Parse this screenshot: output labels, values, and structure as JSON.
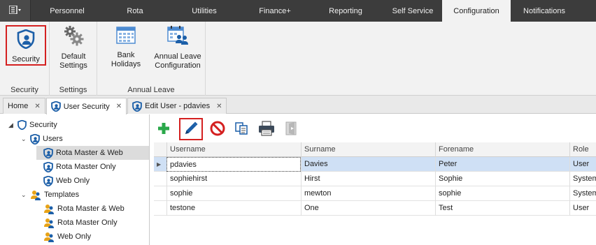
{
  "menubar": {
    "tabs": [
      {
        "label": "Personnel"
      },
      {
        "label": "Rota"
      },
      {
        "label": "Utilities"
      },
      {
        "label": "Finance+"
      },
      {
        "label": "Reporting"
      },
      {
        "label": "Self Service"
      },
      {
        "label": "Configuration"
      },
      {
        "label": "Notifications"
      }
    ],
    "active_tab": "Configuration"
  },
  "ribbon": {
    "security_group": {
      "label": "Security",
      "button_label": "Security"
    },
    "settings_group": {
      "label": "Settings",
      "button_line1": "Default",
      "button_line2": "Settings"
    },
    "annual_leave_group": {
      "label": "Annual Leave",
      "bank_holidays_label": "Bank Holidays",
      "config_line1": "Annual Leave",
      "config_line2": "Configuration"
    }
  },
  "doc_tabs": [
    {
      "label": "Home"
    },
    {
      "label": "User Security"
    },
    {
      "label": "Edit User - pdavies"
    }
  ],
  "tree": {
    "root": "Security",
    "users": "Users",
    "user_items": [
      "Rota Master & Web",
      "Rota Master Only",
      "Web Only"
    ],
    "templates": "Templates",
    "template_items": [
      "Rota Master & Web",
      "Rota Master Only",
      "Web Only"
    ]
  },
  "grid": {
    "columns": [
      "Username",
      "Surname",
      "Forename",
      "Role"
    ],
    "rows": [
      {
        "username": "pdavies",
        "surname": "Davies",
        "forename": "Peter",
        "role": "User"
      },
      {
        "username": "sophiehirst",
        "surname": "Hirst",
        "forename": "Sophie",
        "role": "System"
      },
      {
        "username": "sophie",
        "surname": "mewton",
        "forename": "sophie",
        "role": "System"
      },
      {
        "username": "testone",
        "surname": "One",
        "forename": "Test",
        "role": "User"
      }
    ]
  },
  "colors": {
    "accent_blue": "#1c5fa8",
    "highlight_red": "#d42020",
    "selected_row": "#cfe0f5"
  },
  "icons": {
    "add": "plus-icon",
    "edit": "pencil-icon",
    "delete": "no-entry-icon",
    "copy": "copy-icon",
    "print": "printer-icon",
    "exit": "exit-icon"
  }
}
